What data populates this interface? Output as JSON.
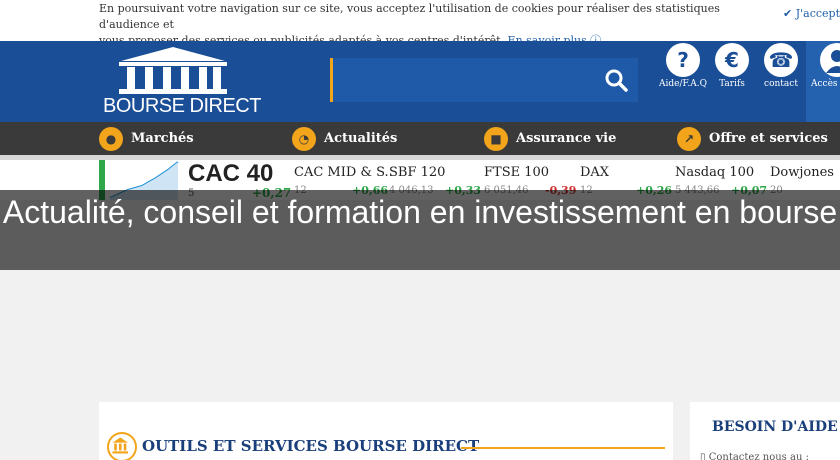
{
  "cookie_bar": {
    "text_line1": "En poursuivant votre navigation sur ce site, vous acceptez l'utilisation de cookies pour réaliser des statistiques d'audience et",
    "text_line2": "vous proposer des services ou publicités adaptés à vos centres d'intérêt.",
    "more_link": "En savoir plus",
    "accept_label": "J'accepte"
  },
  "header": {
    "logo_text": "BOURSE DIRECT",
    "search": {
      "value": "",
      "placeholder": ""
    },
    "tools": [
      {
        "icon": "question-icon",
        "glyph": "?",
        "label": "Aide/F.A.Q"
      },
      {
        "icon": "euro-icon",
        "glyph": "€",
        "label": "Tarifs"
      },
      {
        "icon": "phone-icon",
        "glyph": "☎",
        "label": "contact"
      }
    ],
    "account_label": "Accès c"
  },
  "nav": {
    "items": [
      {
        "icon": "coin-icon",
        "label": "Marchés"
      },
      {
        "icon": "rss-icon",
        "label": "Actualités"
      },
      {
        "icon": "briefcase-icon",
        "label": "Assurance vie"
      },
      {
        "icon": "chart-icon",
        "label": "Offre et services"
      }
    ]
  },
  "ticker": {
    "main": {
      "name": "CAC 40",
      "value": "5",
      "change": "+0,27"
    },
    "indices": [
      {
        "name": "CAC MID & S..",
        "value": "12",
        "change": "+0,66",
        "dir": "up"
      },
      {
        "name": "SBF 120",
        "value": "4 046,13",
        "change": "+0,33",
        "dir": "up"
      },
      {
        "name": "FTSE 100",
        "value": "6 051,46",
        "change": "-0,39",
        "dir": "down"
      },
      {
        "name": "DAX",
        "value": "12",
        "change": "+0,26",
        "dir": "up"
      },
      {
        "name": "Nasdaq 100",
        "value": "5 443,66",
        "change": "+0,07",
        "dir": "up"
      },
      {
        "name": "Dowjones",
        "value": "20",
        "change": "",
        "dir": "up"
      }
    ]
  },
  "overlay": {
    "title": "Actualité, conseil et formation en investissement en bourse"
  },
  "panels": {
    "left_title": "OUTILS ET SERVICES BOURSE DIRECT",
    "right_title": "BESOIN D'AIDE",
    "right_sub": "Contactez nous au :"
  },
  "colors": {
    "brand_blue": "#1a4e97",
    "accent_orange": "#f2a51b",
    "nav_dark": "#3a3a3a",
    "up_green": "#2fa84a",
    "down_red": "#d03030"
  }
}
